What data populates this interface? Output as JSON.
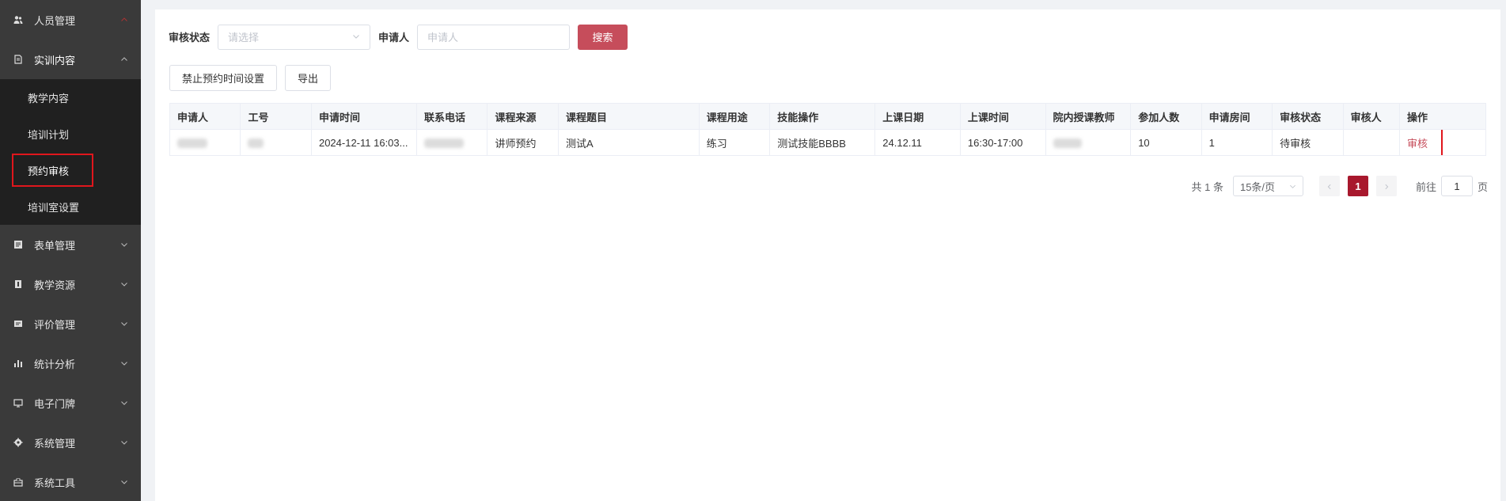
{
  "sidebar": {
    "top_item": {
      "label": "人员管理",
      "icon": "users-icon"
    },
    "expanded": {
      "label": "实训内容",
      "icon": "file-icon"
    },
    "subitems": [
      {
        "label": "教学内容"
      },
      {
        "label": "培训计划"
      },
      {
        "label": "预约审核"
      },
      {
        "label": "培训室设置"
      }
    ],
    "items": [
      {
        "label": "表单管理",
        "icon": "form-icon"
      },
      {
        "label": "教学资源",
        "icon": "book-icon"
      },
      {
        "label": "评价管理",
        "icon": "review-icon"
      },
      {
        "label": "统计分析",
        "icon": "bar-chart-icon"
      },
      {
        "label": "电子门牌",
        "icon": "monitor-icon"
      },
      {
        "label": "系统管理",
        "icon": "gear-icon"
      },
      {
        "label": "系统工具",
        "icon": "toolbox-icon"
      }
    ],
    "colors": {
      "bg": "#3a3a3a",
      "submenu_bg": "#202020",
      "highlight": "#e0161c"
    }
  },
  "filters": {
    "status_label": "审核状态",
    "status_placeholder": "请选择",
    "applicant_label": "申请人",
    "applicant_placeholder": "申请人",
    "search_label": "搜索"
  },
  "actions": {
    "disable_time_label": "禁止预约时间设置",
    "export_label": "导出"
  },
  "table": {
    "headers": [
      "申请人",
      "工号",
      "申请时间",
      "联系电话",
      "课程来源",
      "课程题目",
      "课程用途",
      "技能操作",
      "上课日期",
      "上课时间",
      "院内授课教师",
      "参加人数",
      "申请房间",
      "审核状态",
      "审核人",
      "操作"
    ],
    "rows": [
      {
        "applicant": "",
        "job_no": "",
        "apply_time": "2024-12-11 16:03...",
        "phone": "",
        "source": "讲师预约",
        "title": "测试A",
        "purpose": "练习",
        "skill": "测试技能BBBB",
        "date": "24.12.11",
        "time": "16:30-17:00",
        "teacher": "",
        "count": "10",
        "room": "1",
        "status": "待审核",
        "reviewer": "",
        "op_label": "审核"
      }
    ]
  },
  "pagination": {
    "total_text": "共 1 条",
    "page_size": "15条/页",
    "current_page": "1",
    "goto_label": "前往",
    "goto_value": "1",
    "page_suffix": "页"
  },
  "colors": {
    "primary": "#c64d5b",
    "active_page": "#a8182d"
  }
}
